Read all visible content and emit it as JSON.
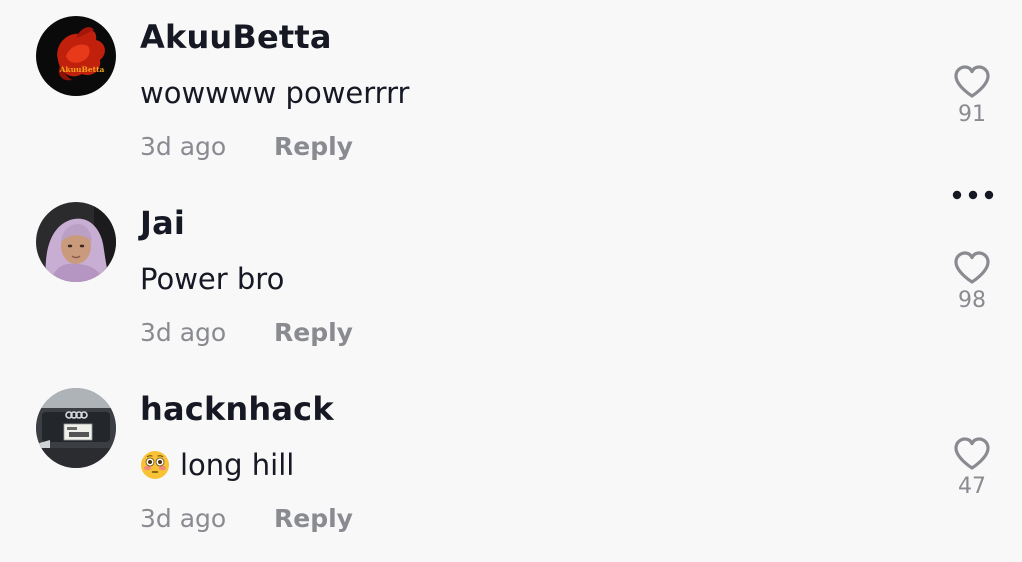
{
  "comments": [
    {
      "username": "AkuuBetta",
      "avatar_text": "AkuuBetta",
      "text": "wowwww powerrrr",
      "emoji": "",
      "time": "3d ago",
      "reply_label": "Reply",
      "likes": "91"
    },
    {
      "username": "Jai",
      "text": "Power bro",
      "emoji": "",
      "time": "3d ago",
      "reply_label": "Reply",
      "likes": "98",
      "more_icon": "more-horizontal-icon"
    },
    {
      "username": "hacknhack",
      "text": "long hill",
      "emoji": "flushed-face",
      "time": "3d ago",
      "reply_label": "Reply",
      "likes": "47"
    }
  ],
  "colors": {
    "background": "#f8f8f8",
    "primary_text": "#161823",
    "secondary_text": "#8a8b91"
  }
}
